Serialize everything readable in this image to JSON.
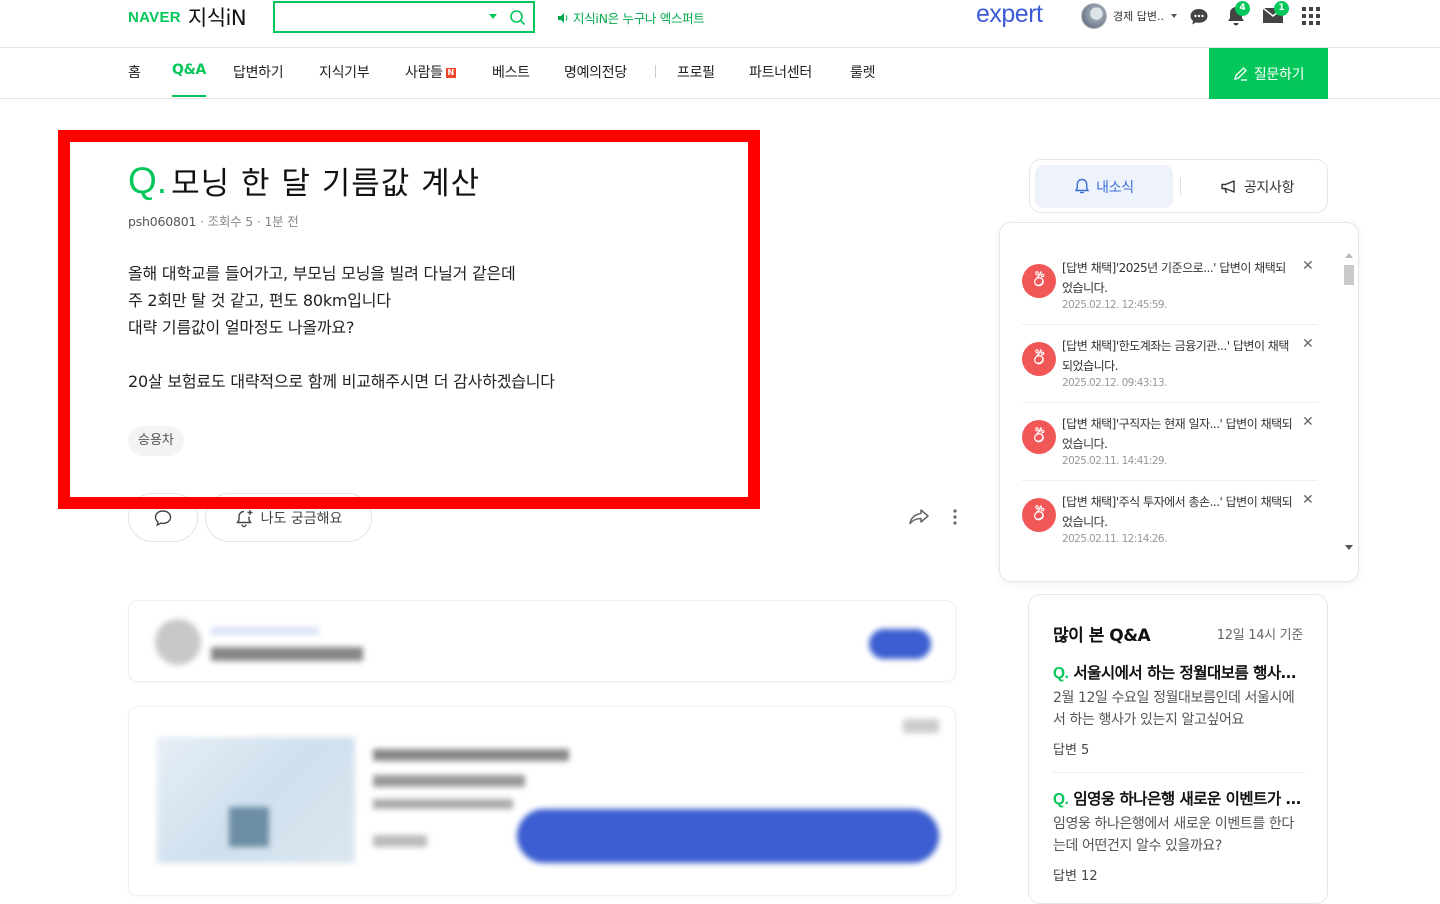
{
  "header": {
    "logo_naver": "NAVER",
    "logo_service": "지식iN",
    "search_value": "",
    "expert_ad": "지식iN은 누구나 엑스퍼트",
    "expert_logo": "expert",
    "user_name": "경제 답변..",
    "notification_count": "4",
    "mail_count": "1"
  },
  "nav": {
    "items": [
      "홈",
      "Q&A",
      "답변하기",
      "지식기부",
      "사람들",
      "베스트",
      "명예의전당",
      "프로필",
      "파트너센터",
      "룰렛"
    ],
    "active": "Q&A",
    "new_tag": "N",
    "ask_button": "질문하기"
  },
  "question": {
    "mark": "Q.",
    "title": "모닝 한 달 기름값 계산",
    "author": "psh060801",
    "views": "조회수 5",
    "time": "1분 전",
    "body": [
      "올해 대학교를 들어가고, 부모님 모닝을 빌려 다닐거 같은데",
      "주 2회만 탈 것 같고, 편도 80km입니다",
      "대략 기름값이 얼마정도 나올까요?",
      "",
      "20살 보험료도 대략적으로 함께 비교해주시면 더 감사하겠습니다"
    ],
    "tag": "승용차",
    "curious_button": "나도 궁금해요"
  },
  "sidebar": {
    "tab_mine": "내소식",
    "tab_notice": "공지사항",
    "notifications": [
      {
        "text": "[답변 채택]'2025년 기준으로...' 답변이 채택되었습니다.",
        "time": "2025.02.12. 12:45:59."
      },
      {
        "text": "[답변 채택]'한도계좌는 금융기관...' 답변이 채택되었습니다.",
        "time": "2025.02.12. 09:43:13."
      },
      {
        "text": "[답변 채택]'구직자는 현재 일자...' 답변이 채택되었습니다.",
        "time": "2025.02.11. 14:41:29."
      },
      {
        "text": "[답변 채택]'주식 투자에서 총손...' 답변이 채택되었습니다.",
        "time": "2025.02.11. 12:14:26."
      }
    ],
    "popular_title": "많이 본 Q&A",
    "popular_basis": "12일 14시 기준",
    "popular": [
      {
        "q": "서울시에서 하는 정월대보름 행사가 있나요?",
        "body": "2월 12일 수요일 정월대보름인데 서울시에서 하는 행사가 있는지 알고싶어요",
        "answers": "답변 5"
      },
      {
        "q": "임영웅 하나은행 새로운 이벤트가 있나요?",
        "body": "임영웅 하나은행에서 새로운 이벤트를 한다는데 어떤건지 알수 있을까요?",
        "answers": "답변 12"
      }
    ]
  }
}
